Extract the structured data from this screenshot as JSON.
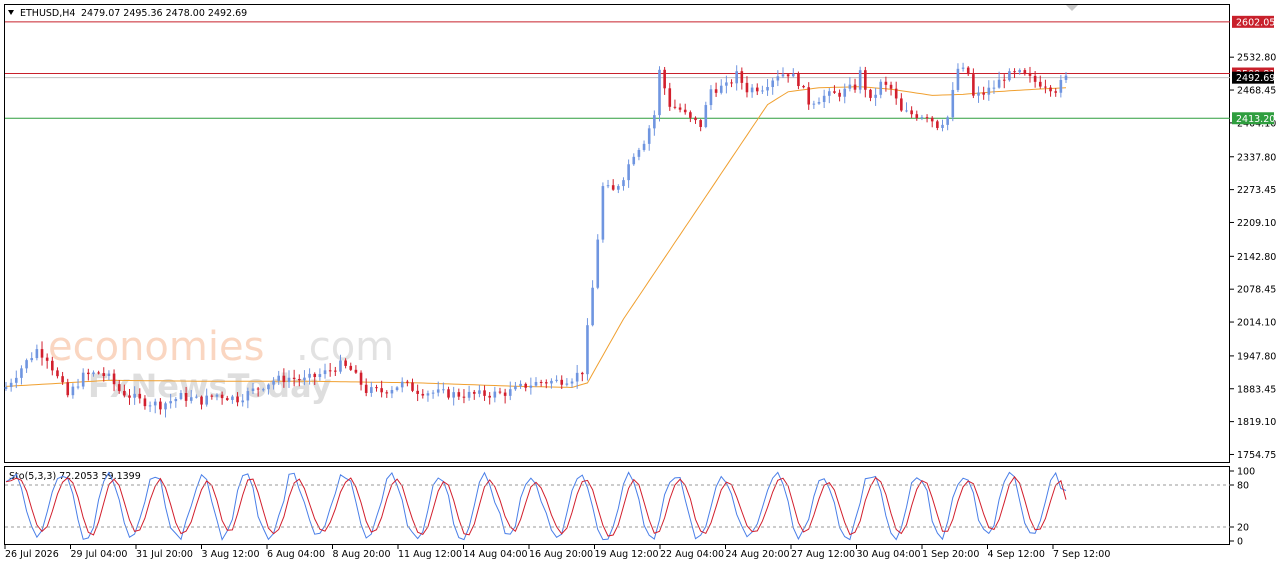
{
  "header": {
    "symbol": "ETHUSD,H4",
    "ohlc": "2479.07 2495.36 2478.00 2492.69"
  },
  "watermark": {
    "brand_colored": "economies",
    "brand_suffix": ".com",
    "brand_second": "FxNewsToday"
  },
  "colors": {
    "bull": "#6f95e0",
    "bear": "#d21f2d",
    "ma": "#f0a030",
    "level_red": "#c8202b",
    "level_green": "#2f9e3f",
    "stoch_main": "#4a7fe8",
    "stoch_signal": "#d21f2d",
    "grid_dots": "#9a9a9a"
  },
  "chart_data": {
    "type": "candlestick",
    "symbol": "ETHUSD",
    "timeframe": "H4",
    "ylim": [
      1740,
      2635
    ],
    "y_ticks": [
      "2532.80",
      "2468.45",
      "2404.10",
      "2337.80",
      "2273.45",
      "2209.10",
      "2142.80",
      "2078.45",
      "2014.10",
      "1947.80",
      "1883.45",
      "1819.10",
      "1754.75"
    ],
    "x_ticks": [
      "26 Jul 2026",
      "29 Jul 04:00",
      "31 Jul 20:00",
      "3 Aug 12:00",
      "6 Aug 04:00",
      "8 Aug 20:00",
      "11 Aug 12:00",
      "14 Aug 04:00",
      "16 Aug 20:00",
      "19 Aug 12:00",
      "22 Aug 04:00",
      "24 Aug 20:00",
      "27 Aug 12:00",
      "30 Aug 04:00",
      "1 Sep 20:00",
      "4 Sep 12:00",
      "7 Sep 12:00"
    ],
    "levels": [
      {
        "value": 2602.05,
        "label": "2602.05",
        "color": "red"
      },
      {
        "value": 2500.81,
        "label": "2500.81",
        "color": "red"
      },
      {
        "value": 2413.2,
        "label": "2413.20",
        "color": "green"
      }
    ],
    "current_price": 2492.69,
    "current_price_label": "2492.69",
    "candles_close_path": [
      [
        0,
        1887
      ],
      [
        3,
        1925
      ],
      [
        6,
        1960
      ],
      [
        8,
        1945
      ],
      [
        10,
        1905
      ],
      [
        12,
        1870
      ],
      [
        15,
        1908
      ],
      [
        18,
        1915
      ],
      [
        20,
        1905
      ],
      [
        22,
        1880
      ],
      [
        26,
        1860
      ],
      [
        30,
        1852
      ],
      [
        34,
        1868
      ],
      [
        38,
        1860
      ],
      [
        41,
        1872
      ],
      [
        45,
        1864
      ],
      [
        48,
        1880
      ],
      [
        52,
        1900
      ],
      [
        55,
        1905
      ],
      [
        58,
        1900
      ],
      [
        62,
        1915
      ],
      [
        65,
        1930
      ],
      [
        67,
        1920
      ],
      [
        70,
        1880
      ],
      [
        73,
        1878
      ],
      [
        77,
        1893
      ],
      [
        80,
        1880
      ],
      [
        83,
        1876
      ],
      [
        88,
        1872
      ],
      [
        92,
        1872
      ],
      [
        96,
        1874
      ],
      [
        98,
        1878
      ],
      [
        101,
        1890
      ],
      [
        104,
        1897
      ],
      [
        107,
        1898
      ],
      [
        110,
        1905
      ],
      [
        112,
        1918
      ],
      [
        114,
        2080
      ],
      [
        116,
        2278
      ],
      [
        118,
        2270
      ],
      [
        120,
        2300
      ],
      [
        122,
        2345
      ],
      [
        124,
        2370
      ],
      [
        126,
        2420
      ],
      [
        127,
        2505
      ],
      [
        129,
        2440
      ],
      [
        131,
        2430
      ],
      [
        133,
        2410
      ],
      [
        135,
        2400
      ],
      [
        137,
        2470
      ],
      [
        140,
        2475
      ],
      [
        142,
        2498
      ],
      [
        144,
        2470
      ],
      [
        147,
        2475
      ],
      [
        150,
        2500
      ],
      [
        152,
        2502
      ],
      [
        154,
        2485
      ],
      [
        156,
        2445
      ],
      [
        159,
        2456
      ],
      [
        162,
        2462
      ],
      [
        165,
        2475
      ],
      [
        166,
        2502
      ],
      [
        168,
        2445
      ],
      [
        170,
        2480
      ],
      [
        172,
        2470
      ],
      [
        174,
        2425
      ],
      [
        177,
        2420
      ],
      [
        179,
        2420
      ],
      [
        181,
        2400
      ],
      [
        183,
        2415
      ],
      [
        185,
        2510
      ],
      [
        187,
        2500
      ],
      [
        188,
        2455
      ],
      [
        190,
        2462
      ],
      [
        192,
        2475
      ],
      [
        194,
        2495
      ],
      [
        197,
        2500
      ],
      [
        200,
        2485
      ],
      [
        202,
        2480
      ],
      [
        204,
        2470
      ],
      [
        206,
        2492
      ]
    ],
    "moving_average_path": [
      [
        0,
        1888
      ],
      [
        10,
        1894
      ],
      [
        20,
        1900
      ],
      [
        40,
        1898
      ],
      [
        60,
        1898
      ],
      [
        80,
        1895
      ],
      [
        100,
        1888
      ],
      [
        110,
        1886
      ],
      [
        113,
        1895
      ],
      [
        120,
        2020
      ],
      [
        130,
        2170
      ],
      [
        140,
        2320
      ],
      [
        148,
        2440
      ],
      [
        152,
        2465
      ],
      [
        158,
        2473
      ],
      [
        166,
        2475
      ],
      [
        172,
        2470
      ],
      [
        180,
        2458
      ],
      [
        186,
        2460
      ],
      [
        192,
        2465
      ],
      [
        200,
        2470
      ],
      [
        206,
        2473
      ]
    ],
    "candle_count": 207,
    "stochastic": {
      "label": "Sto(5,3,3) 72.2053 59.1399",
      "main": 72.2053,
      "signal": 59.1399,
      "ylim": [
        0,
        100
      ],
      "y_ticks": [
        "100",
        "80",
        "20",
        "0"
      ],
      "levels": [
        80,
        20
      ]
    }
  }
}
